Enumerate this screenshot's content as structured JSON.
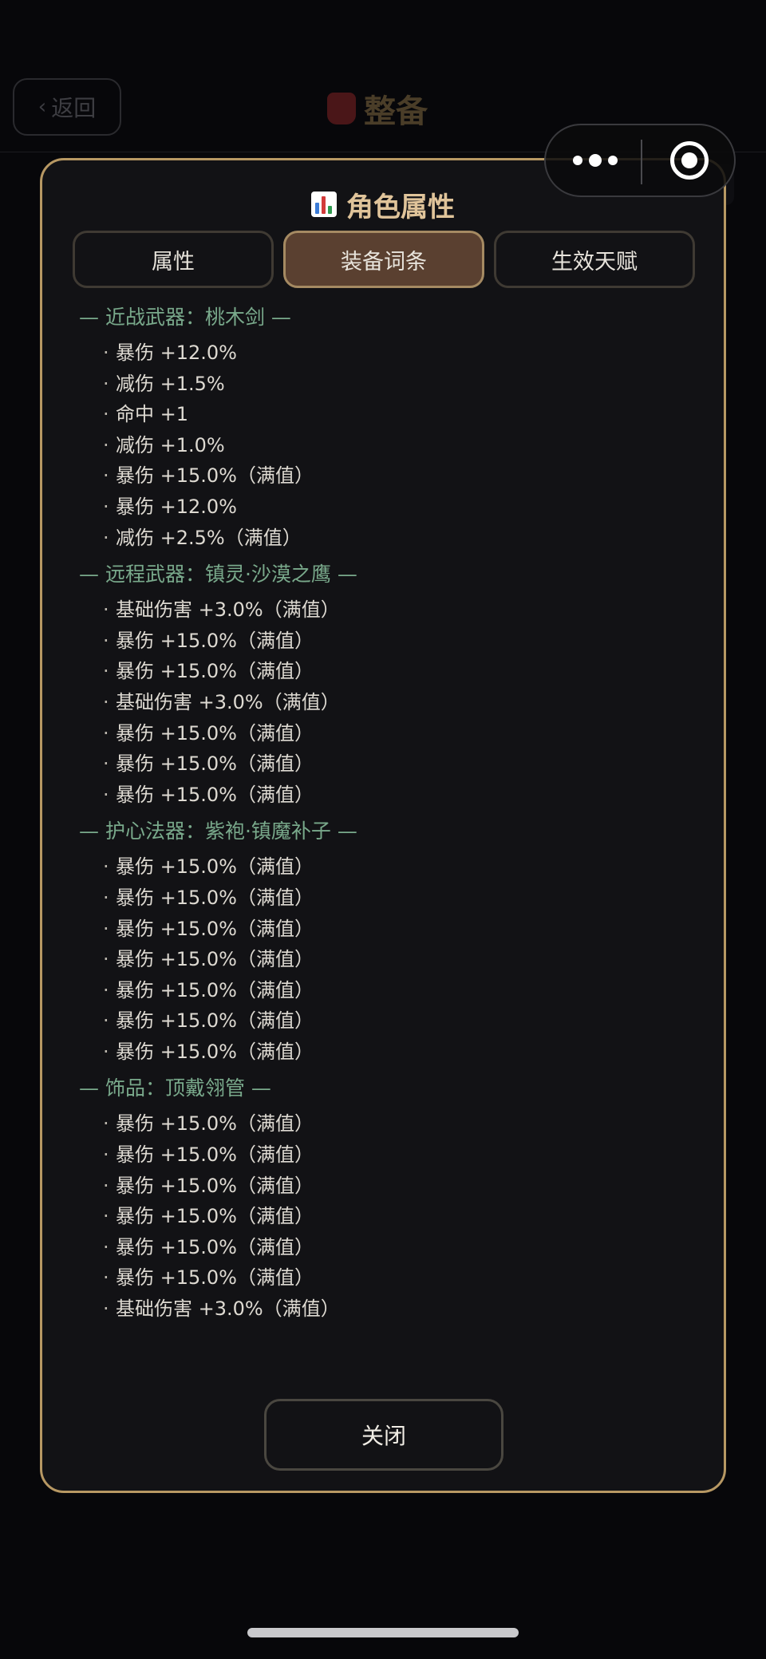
{
  "background": {
    "back_label": "返回",
    "title": "整备"
  },
  "modal": {
    "title": "角色属性",
    "tabs": [
      {
        "label": "属性",
        "active": false
      },
      {
        "label": "装备词条",
        "active": true
      },
      {
        "label": "生效天赋",
        "active": false
      }
    ],
    "sections": [
      {
        "heading": "— 近战武器：桃木剑 —",
        "items": [
          "暴伤 +12.0%",
          "减伤 +1.5%",
          "命中 +1",
          "减伤 +1.0%",
          "暴伤 +15.0%（满值）",
          "暴伤 +12.0%",
          "减伤 +2.5%（满值）"
        ]
      },
      {
        "heading": "— 远程武器：镇灵·沙漠之鹰 —",
        "items": [
          "基础伤害 +3.0%（满值）",
          "暴伤 +15.0%（满值）",
          "暴伤 +15.0%（满值）",
          "基础伤害 +3.0%（满值）",
          "暴伤 +15.0%（满值）",
          "暴伤 +15.0%（满值）",
          "暴伤 +15.0%（满值）"
        ]
      },
      {
        "heading": "— 护心法器：紫袍·镇魔补子 —",
        "items": [
          "暴伤 +15.0%（满值）",
          "暴伤 +15.0%（满值）",
          "暴伤 +15.0%（满值）",
          "暴伤 +15.0%（满值）",
          "暴伤 +15.0%（满值）",
          "暴伤 +15.0%（满值）",
          "暴伤 +15.0%（满值）"
        ]
      },
      {
        "heading": "— 饰品：顶戴翎管 —",
        "items": [
          "暴伤 +15.0%（满值）",
          "暴伤 +15.0%（满值）",
          "暴伤 +15.0%（满值）",
          "暴伤 +15.0%（满值）",
          "暴伤 +15.0%（满值）",
          "暴伤 +15.0%（满值）",
          "基础伤害 +3.0%（满值）"
        ]
      }
    ],
    "bullet": "·",
    "close_label": "关闭"
  },
  "colors": {
    "border_gold": "#b79863",
    "title_gold": "#e0c49a",
    "section_green": "#79a98b",
    "active_tab": "#5a4030"
  }
}
